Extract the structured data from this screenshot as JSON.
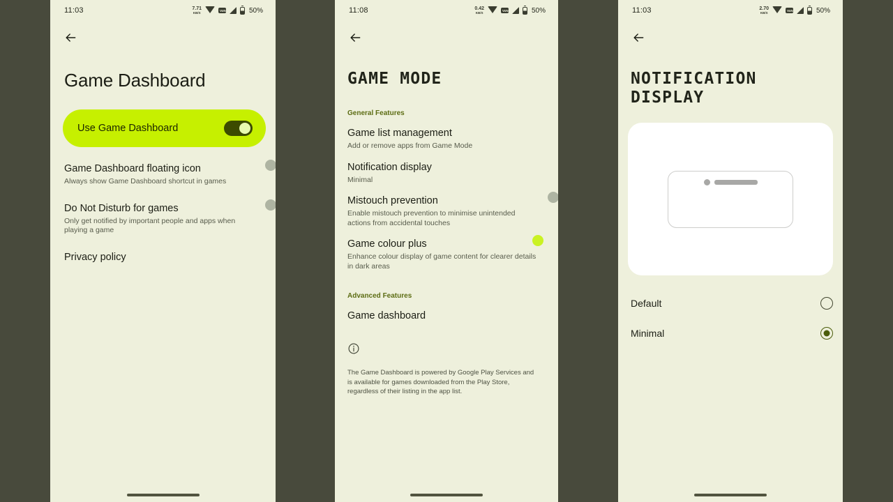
{
  "theme": {
    "outer_background": "#484a3c",
    "screen_background": "#eef0dc",
    "accent_green": "#c6f000",
    "accent_dark_olive": "#3c4b00",
    "section_label_color": "#5d6d14",
    "toggle_off_track": "#6b7060"
  },
  "phones": [
    {
      "status": {
        "time": "11:03",
        "net_speed_value": "7.71",
        "net_speed_unit": "KB/S",
        "vonr_label": "VoNR",
        "battery_percent": "50%"
      },
      "title": "Game Dashboard",
      "banner": {
        "label": "Use Game Dashboard",
        "state": "on"
      },
      "rows": [
        {
          "primary": "Game Dashboard floating icon",
          "secondary": "Always show Game Dashboard shortcut in games",
          "control": "switch-off"
        },
        {
          "primary": "Do Not Disturb for games",
          "secondary": "Only get notified by important people and apps when playing a game",
          "control": "switch-off"
        },
        {
          "primary": "Privacy policy",
          "secondary": "",
          "control": "none"
        }
      ]
    },
    {
      "status": {
        "time": "11:08",
        "net_speed_value": "0.42",
        "net_speed_unit": "KB/S",
        "vonr_label": "VoNR",
        "battery_percent": "50%"
      },
      "title": "GAME MODE",
      "sections": [
        {
          "label": "General Features",
          "rows": [
            {
              "primary": "Game list management",
              "secondary": "Add or remove apps from Game Mode",
              "control": "none"
            },
            {
              "primary": "Notification display",
              "secondary": "Minimal",
              "control": "none"
            },
            {
              "primary": "Mistouch prevention",
              "secondary": "Enable mistouch prevention to minimise unintended actions from accidental touches",
              "control": "switch-off"
            },
            {
              "primary": "Game colour plus",
              "secondary": "Enhance colour display of game content for clearer details in dark areas",
              "control": "switch-on"
            }
          ]
        },
        {
          "label": "Advanced Features",
          "rows": [
            {
              "primary": "Game dashboard",
              "secondary": "",
              "control": "none"
            }
          ]
        }
      ],
      "footer": {
        "icon": "info-icon",
        "text": "The Game Dashboard is powered by Google Play Services and is available for games downloaded from the Play Store, regardless of their listing in the app list."
      }
    },
    {
      "status": {
        "time": "11:03",
        "net_speed_value": "2.70",
        "net_speed_unit": "KB/S",
        "vonr_label": "VoNR",
        "battery_percent": "50%"
      },
      "title_line_1": "NOTIFICATION",
      "title_line_2": "DISPLAY",
      "preview": {
        "style": "minimal-notification-preview"
      },
      "options": [
        {
          "label": "Default",
          "selected": false
        },
        {
          "label": "Minimal",
          "selected": true
        }
      ]
    }
  ]
}
